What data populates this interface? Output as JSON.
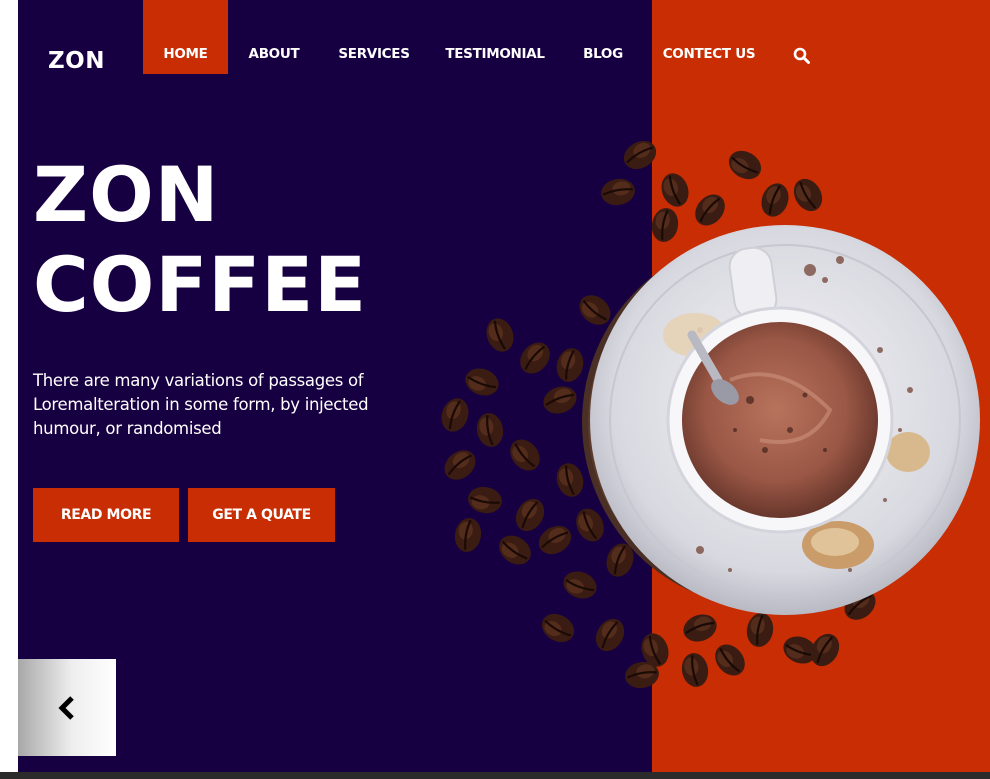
{
  "brand": {
    "logo": "ZON"
  },
  "nav": {
    "items": [
      {
        "label": "HOME",
        "active": true
      },
      {
        "label": "ABOUT"
      },
      {
        "label": "SERVICES"
      },
      {
        "label": "TESTIMONIAL"
      },
      {
        "label": "BLOG"
      },
      {
        "label": "CONTECT US"
      }
    ],
    "search_icon": "search-icon"
  },
  "hero": {
    "title_line1": "ZON",
    "title_line2": "COFFEE",
    "description": "There are many variations of passages of Loremalteration in some form, by injected humour, or randomised",
    "read_more_label": "READ MORE",
    "quote_label": "GET A QUATE"
  },
  "slider": {
    "prev_icon": "chevron-left-icon"
  },
  "colors": {
    "dark_bg": "#170041",
    "accent": "#c82d03",
    "text": "#ffffff"
  }
}
